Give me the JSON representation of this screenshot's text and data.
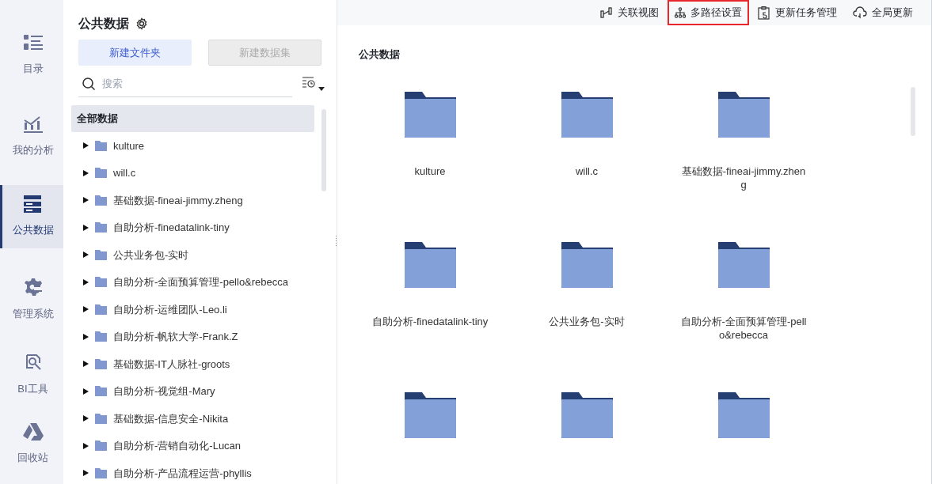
{
  "nav": [
    {
      "label": "目录",
      "selected": false
    },
    {
      "label": "我的分析",
      "selected": false
    },
    {
      "label": "公共数据",
      "selected": true
    },
    {
      "label": "管理系统",
      "selected": false
    },
    {
      "label": "BI工具",
      "selected": false
    },
    {
      "label": "回收站",
      "selected": false
    }
  ],
  "panel": {
    "title": "公共数据",
    "buttons": [
      {
        "label": "新建文件夹",
        "disabled": false
      },
      {
        "label": "新建数据集",
        "disabled": true
      }
    ],
    "search": {
      "placeholder": "搜索"
    },
    "tree": {
      "label": "全部数据",
      "selected": true,
      "children": [
        {
          "label": "kulture",
          "expanded": false
        },
        {
          "label": "will.c",
          "expanded": false
        },
        {
          "label": "基础数据-fineai-jimmy.zheng",
          "expanded": false
        },
        {
          "label": "自助分析-finedatalink-tiny",
          "expanded": false
        },
        {
          "label": "公共业务包-实时",
          "expanded": false
        },
        {
          "label": "自助分析-全面预算管理-pello&rebecca",
          "expanded": false
        },
        {
          "label": "自助分析-运维团队-Leo.li",
          "expanded": false
        },
        {
          "label": "自助分析-帆软大学-Frank.Z",
          "expanded": false
        },
        {
          "label": "基础数据-IT人脉社-groots",
          "expanded": false
        },
        {
          "label": "自助分析-视觉组-Mary",
          "expanded": false
        },
        {
          "label": "基础数据-信息安全-Nikita",
          "expanded": false
        },
        {
          "label": "自助分析-营销自动化-Lucan",
          "expanded": false
        },
        {
          "label": "自助分析-产品流程运营-phyllis",
          "expanded": false
        }
      ]
    }
  },
  "toolbar": [
    {
      "label": "关联视图",
      "highlighted": false
    },
    {
      "label": "多路径设置",
      "highlighted": true
    },
    {
      "label": "更新任务管理",
      "highlighted": false
    },
    {
      "label": "全局更新",
      "highlighted": false
    }
  ],
  "content": {
    "title": "公共数据",
    "folders": [
      {
        "label": "kulture"
      },
      {
        "label": "will.c"
      },
      {
        "label": "基础数据-fineai-jimmy.zheng"
      },
      {
        "label": "自助分析-finedatalink-tiny"
      },
      {
        "label": "公共业务包-实时"
      },
      {
        "label": "自助分析-全面预算管理-pello&rebecca"
      },
      {
        "kind": "folder"
      },
      {
        "kind": "folder"
      },
      {
        "kind": "folder"
      }
    ]
  }
}
